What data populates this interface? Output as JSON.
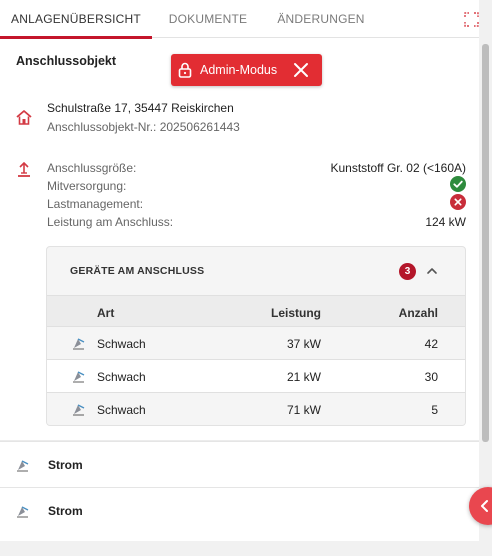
{
  "tabs": [
    {
      "label": "ANLAGENÜBERSICHT",
      "active": true
    },
    {
      "label": "DOKUMENTE",
      "active": false
    },
    {
      "label": "ÄNDERUNGEN",
      "active": false
    }
  ],
  "header": {
    "fullscreen_icon": "fullscreen-icon"
  },
  "section": {
    "title": "Anschlussobjekt"
  },
  "admin_badge": {
    "label": "Admin-Modus",
    "icon": "lock-icon",
    "close_icon": "close-icon",
    "color": "#e22d33"
  },
  "address": {
    "icon": "house-icon",
    "street": "Schulstraße 17, 35447 Reiskirchen",
    "object_nr": "Anschlussobjekt-Nr.: 202506261443"
  },
  "details": {
    "icon": "connection-icon",
    "rows": [
      {
        "label": "Anschlussgröße:",
        "value": "Kunststoff Gr. 02 (<160A)"
      },
      {
        "label": "Mitversorgung:",
        "status": "yes",
        "status_icon": "check-icon",
        "color": "#2e8b3d"
      },
      {
        "label": "Lastmanagement:",
        "status": "no",
        "status_icon": "x-icon",
        "color": "#c82d3a"
      },
      {
        "label": "Leistung am Anschluss:",
        "value": "124 kW"
      }
    ]
  },
  "devices": {
    "title": "GERÄTE AM ANSCHLUSS",
    "count": "3",
    "expanded": true,
    "columns": {
      "art": "Art",
      "leistung": "Leistung",
      "anzahl": "Anzahl"
    },
    "rows": [
      {
        "art": "Schwach",
        "leistung": "37 kW",
        "anzahl": "42",
        "icon": "device-icon"
      },
      {
        "art": "Schwach",
        "leistung": "21 kW",
        "anzahl": "30",
        "icon": "device-icon"
      },
      {
        "art": "Schwach",
        "leistung": "71 kW",
        "anzahl": "5",
        "icon": "device-icon"
      }
    ]
  },
  "list": [
    {
      "label": "Strom",
      "icon": "power-icon"
    },
    {
      "label": "Strom",
      "icon": "power-icon"
    }
  ],
  "fab": {
    "icon": "chevron-left-icon",
    "color": "#e9474f"
  },
  "accent": "#c4152b"
}
